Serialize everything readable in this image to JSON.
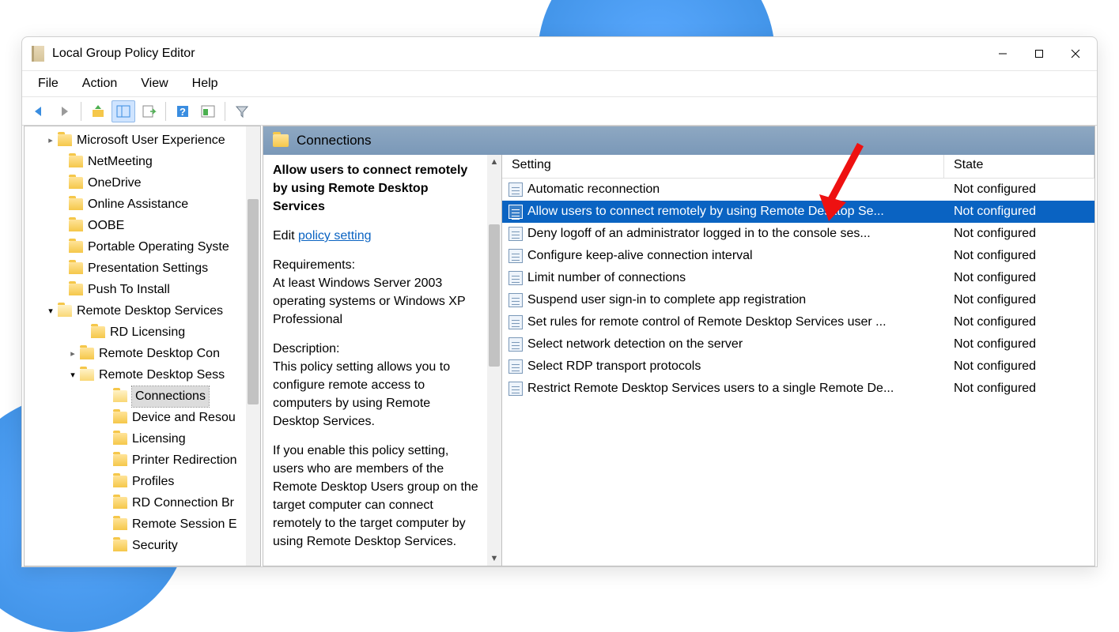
{
  "app": {
    "title": "Local Group Policy Editor"
  },
  "menu": {
    "file": "File",
    "action": "Action",
    "view": "View",
    "help": "Help"
  },
  "pane": {
    "title": "Connections"
  },
  "detail": {
    "title": "Allow users to connect remotely by using Remote Desktop Services",
    "edit_label": "Edit ",
    "link": "policy setting",
    "req_h": "Requirements:",
    "req_t": "At least Windows Server 2003 operating systems or Windows XP Professional",
    "desc_h": "Description:",
    "desc_t": "This policy setting allows you to configure remote access to computers by using Remote Desktop Services.",
    "long": "If you enable this policy setting, users who are members of the Remote Desktop Users group on the target computer can connect remotely to the target computer by using Remote Desktop Services."
  },
  "listHeader": {
    "setting": "Setting",
    "state": "State"
  },
  "settings": [
    {
      "name": "Automatic reconnection",
      "state": "Not configured",
      "selected": false
    },
    {
      "name": "Allow users to connect remotely by using Remote Desktop Se...",
      "state": "Not configured",
      "selected": true
    },
    {
      "name": "Deny logoff of an administrator logged in to the console ses...",
      "state": "Not configured",
      "selected": false
    },
    {
      "name": "Configure keep-alive connection interval",
      "state": "Not configured",
      "selected": false
    },
    {
      "name": "Limit number of connections",
      "state": "Not configured",
      "selected": false
    },
    {
      "name": "Suspend user sign-in to complete app registration",
      "state": "Not configured",
      "selected": false
    },
    {
      "name": "Set rules for remote control of Remote Desktop Services user ...",
      "state": "Not configured",
      "selected": false
    },
    {
      "name": "Select network detection on the server",
      "state": "Not configured",
      "selected": false
    },
    {
      "name": "Select RDP transport protocols",
      "state": "Not configured",
      "selected": false
    },
    {
      "name": "Restrict Remote Desktop Services users to a single Remote De...",
      "state": "Not configured",
      "selected": false
    }
  ],
  "tree": [
    {
      "indent": 26,
      "chev": ">",
      "label": "Microsoft User Experience"
    },
    {
      "indent": 40,
      "chev": "",
      "label": "NetMeeting"
    },
    {
      "indent": 40,
      "chev": "",
      "label": "OneDrive"
    },
    {
      "indent": 40,
      "chev": "",
      "label": "Online Assistance"
    },
    {
      "indent": 40,
      "chev": "",
      "label": "OOBE"
    },
    {
      "indent": 40,
      "chev": "",
      "label": "Portable Operating Syste"
    },
    {
      "indent": 40,
      "chev": "",
      "label": "Presentation Settings"
    },
    {
      "indent": 40,
      "chev": "",
      "label": "Push To Install"
    },
    {
      "indent": 26,
      "chev": "v",
      "label": "Remote Desktop Services",
      "open": true
    },
    {
      "indent": 68,
      "chev": "",
      "label": "RD Licensing"
    },
    {
      "indent": 54,
      "chev": ">",
      "label": "Remote Desktop Con"
    },
    {
      "indent": 54,
      "chev": "v",
      "label": "Remote Desktop Sess",
      "open": true
    },
    {
      "indent": 96,
      "chev": "",
      "label": "Connections",
      "open": true,
      "selected": true
    },
    {
      "indent": 96,
      "chev": "",
      "label": "Device and Resou"
    },
    {
      "indent": 96,
      "chev": "",
      "label": "Licensing"
    },
    {
      "indent": 96,
      "chev": "",
      "label": "Printer Redirection"
    },
    {
      "indent": 96,
      "chev": "",
      "label": "Profiles"
    },
    {
      "indent": 96,
      "chev": "",
      "label": "RD Connection Br"
    },
    {
      "indent": 96,
      "chev": "",
      "label": "Remote Session E"
    },
    {
      "indent": 96,
      "chev": "",
      "label": "Security"
    }
  ]
}
